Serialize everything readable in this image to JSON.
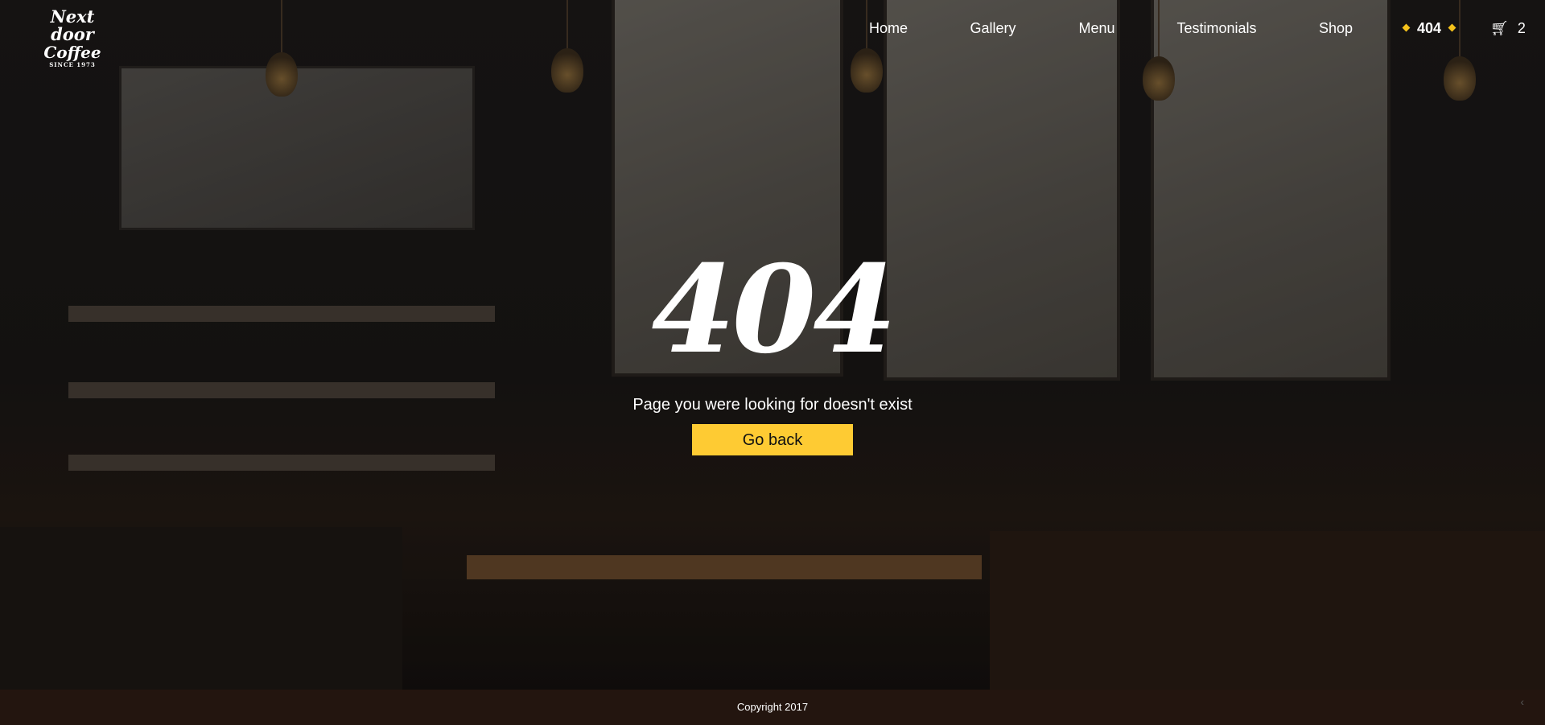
{
  "logo": {
    "line1": "Next door",
    "line2": "Coffee",
    "line3": "SINCE 1973"
  },
  "nav": {
    "items": [
      {
        "label": "Home"
      },
      {
        "label": "Gallery"
      },
      {
        "label": "Menu"
      },
      {
        "label": "Testimonials"
      },
      {
        "label": "Shop"
      },
      {
        "label": "404"
      }
    ],
    "cart_count": "2",
    "active_color": "#f5c21b"
  },
  "hero": {
    "code": "404",
    "message": "Page you were looking for doesn't exist",
    "button": "Go back",
    "button_color": "#fecb33"
  },
  "footer": {
    "copyright": "Copyright 2017"
  }
}
